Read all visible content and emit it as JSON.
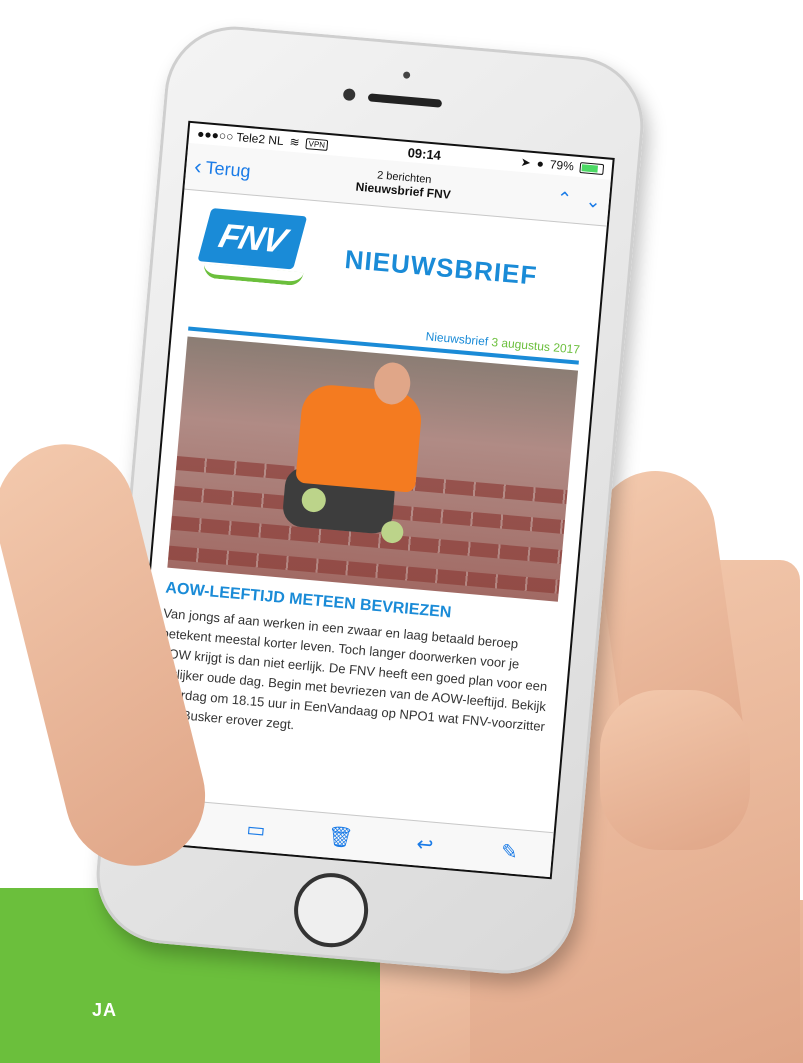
{
  "status_bar": {
    "carrier": "●●●○○ Tele2 NL",
    "vpn": "VPN",
    "time": "09:14",
    "battery": "79%",
    "battery_level": 0.79
  },
  "nav_bar": {
    "back_label": "Terug",
    "message_count": "2 berichten",
    "subject": "Nieuwsbrief FNV"
  },
  "newsletter": {
    "logo_text": "FNV",
    "title": "NIEUWSBRIEF",
    "issue_label": "Nieuwsbrief",
    "issue_date": "3 augustus 2017",
    "article_title": "AOW-LEEFTIJD METEEN BEVRIEZEN",
    "article_body": "Van jongs af aan werken in een zwaar en laag betaald beroep betekent meestal korter leven. Toch langer doorwerken voor je AOW krijgt is dan niet eerlijk. De FNV heeft een goed plan voor een eerlijker oude dag. Begin met bevriezen van de AOW-leeftijd. Bekijk zaterdag om 18.15 uur in EenVandaag op NPO1 wat FNV-voorzitter Han Busker erover zegt."
  },
  "toolbar": {
    "icons": [
      "flag-icon",
      "folder-icon",
      "trash-icon",
      "reply-icon",
      "compose-icon"
    ]
  },
  "colors": {
    "accent_blue": "#1a8bd7",
    "ios_blue": "#1a7be7",
    "fnv_green": "#6bbf3c"
  },
  "footer_band_text": "JA"
}
